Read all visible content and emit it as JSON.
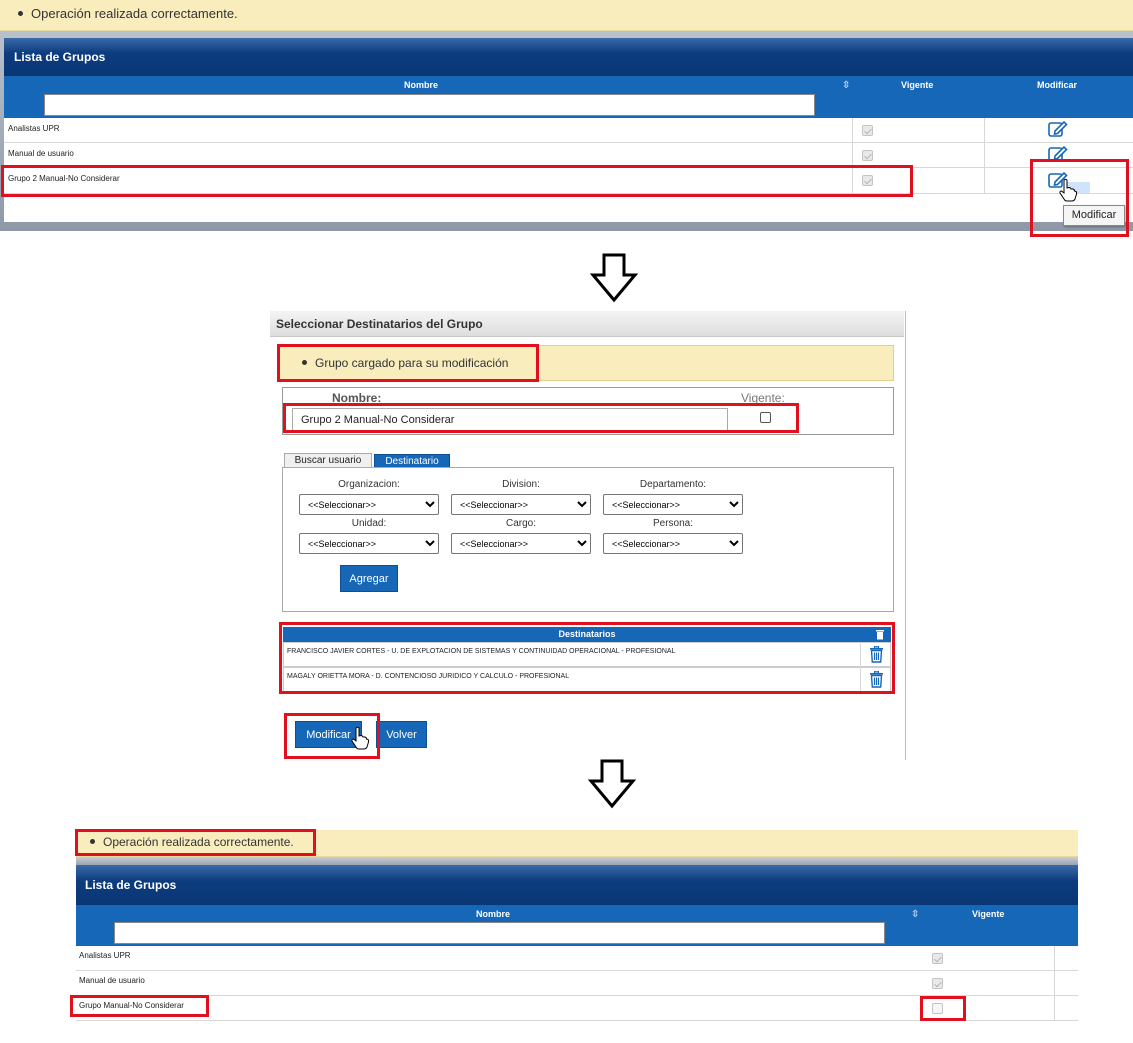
{
  "top": {
    "message": "Operación realizada correctamente.",
    "title": "Lista de Grupos",
    "columns": {
      "nombre": "Nombre",
      "sort": "⇳",
      "vigente": "Vigente",
      "modificar": "Modificar"
    },
    "rows": [
      {
        "name": "Analistas UPR",
        "vigente": true
      },
      {
        "name": "Manual de usuario",
        "vigente": true
      },
      {
        "name": "Grupo 2 Manual-No Considerar",
        "vigente": true
      }
    ],
    "tooltip": "Modificar",
    "icons": {
      "edit": "edit-pencil-icon",
      "cursor": "hand-pointer-icon"
    }
  },
  "middle": {
    "title": "Seleccionar Destinatarios del Grupo",
    "message": "Grupo cargado para su modificación",
    "nombre_label": "Nombre:",
    "vigente_label": "Vigente:",
    "nombre_value": "Grupo 2 Manual-No Considerar",
    "vigente_checked": false,
    "tabs": {
      "buscar": "Buscar usuario",
      "destinatario": "Destinatario",
      "active": "destinatario"
    },
    "filters": {
      "organizacion": "Organizacion:",
      "division": "Division:",
      "departamento": "Departamento:",
      "unidad": "Unidad:",
      "cargo": "Cargo:",
      "persona": "Persona:",
      "placeholder": "<<Seleccionar>>"
    },
    "agregar": "Agregar",
    "destinatarios_header": "Destinatarios",
    "destinatarios": [
      "FRANCISCO JAVIER CORTES - U. DE EXPLOTACION DE SISTEMAS Y CONTINUIDAD OPERACIONAL - PROFESIONAL",
      "MAGALY ORIETTA MORA - D. CONTENCIOSO JURIDICO Y CALCULO - PROFESIONAL"
    ],
    "modificar": "Modificar",
    "volver": "Volver"
  },
  "bottom": {
    "message": "Operación realizada correctamente.",
    "title": "Lista de Grupos",
    "columns": {
      "nombre": "Nombre",
      "sort": "⇳",
      "vigente": "Vigente"
    },
    "rows": [
      {
        "name": "Analistas UPR",
        "vigente": true
      },
      {
        "name": "Manual de usuario",
        "vigente": true
      },
      {
        "name": "Grupo Manual-No Considerar",
        "vigente": false
      }
    ]
  },
  "colors": {
    "accent": "#1767b8",
    "highlight": "#e0101e",
    "message_bg": "#f9edbe"
  }
}
